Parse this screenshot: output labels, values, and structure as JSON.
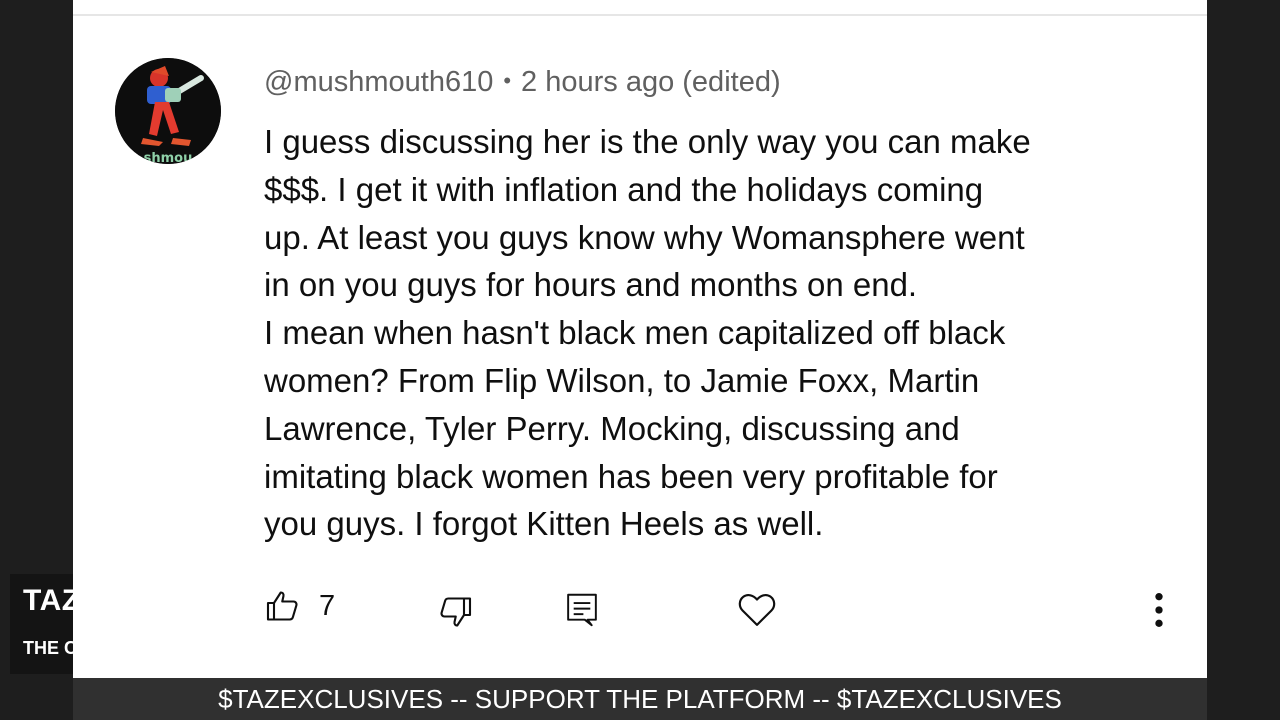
{
  "overlay": {
    "title": "TAZ",
    "subtitle": "THE C"
  },
  "comment": {
    "username": "@mushmouth610",
    "separator": "•",
    "timestamp": "2 hours ago (edited)",
    "lines": [
      "I guess discussing her is the only way you can make",
      "$$$. I get it with inflation and the holidays coming",
      "up. At least you guys know why Womansphere went",
      "in on you guys for hours and months on end.",
      "I mean when hasn't black men capitalized off black",
      "women? From Flip Wilson, to Jamie Foxx, Martin",
      "Lawrence, Tyler Perry. Mocking, discussing and",
      "imitating black women has been very profitable for",
      "you guys. I forgot Kitten Heels as well."
    ],
    "avatar_text": "shmou"
  },
  "actions": {
    "like_icon": "thumbs-up-icon",
    "like_count": "7",
    "dislike_icon": "thumbs-down-icon",
    "reply_icon": "reply-icon",
    "heart_icon": "heart-icon",
    "more_icon": "more-vertical-icon"
  },
  "ticker": {
    "text": "$TAZEXCLUSIVES -- SUPPORT THE PLATFORM -- $TAZEXCLUSIVES"
  }
}
